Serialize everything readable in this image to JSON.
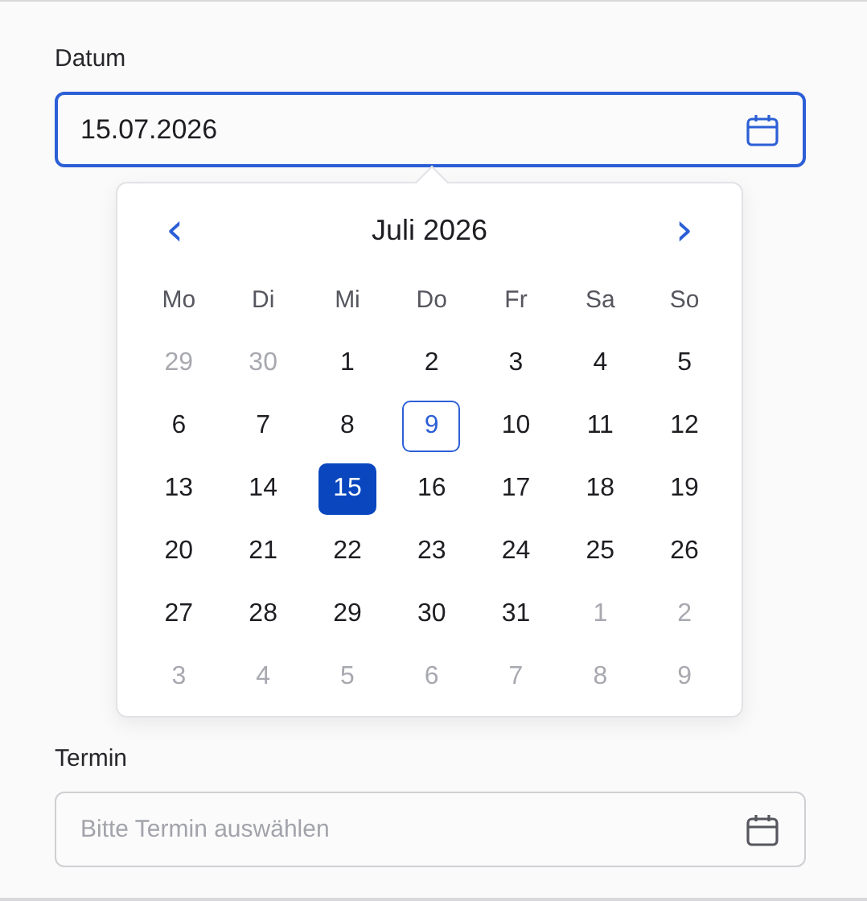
{
  "date_field": {
    "label": "Datum",
    "value": "15.07.2026",
    "focused": true
  },
  "calendar": {
    "prev": "‹",
    "next": "›",
    "month_title": "Juli 2026",
    "weekdays": [
      "Mo",
      "Di",
      "Mi",
      "Do",
      "Fr",
      "Sa",
      "So"
    ],
    "weeks": [
      [
        {
          "text": "29",
          "in_month": false,
          "selected": false,
          "today": false
        },
        {
          "text": "30",
          "in_month": false,
          "selected": false,
          "today": false
        },
        {
          "text": "1",
          "in_month": true,
          "selected": false,
          "today": false
        },
        {
          "text": "2",
          "in_month": true,
          "selected": false,
          "today": false
        },
        {
          "text": "3",
          "in_month": true,
          "selected": false,
          "today": false
        },
        {
          "text": "4",
          "in_month": true,
          "selected": false,
          "today": false
        },
        {
          "text": "5",
          "in_month": true,
          "selected": false,
          "today": false
        }
      ],
      [
        {
          "text": "6",
          "in_month": true,
          "selected": false,
          "today": false
        },
        {
          "text": "7",
          "in_month": true,
          "selected": false,
          "today": false
        },
        {
          "text": "8",
          "in_month": true,
          "selected": false,
          "today": false
        },
        {
          "text": "9",
          "in_month": true,
          "selected": false,
          "today": true
        },
        {
          "text": "10",
          "in_month": true,
          "selected": false,
          "today": false
        },
        {
          "text": "11",
          "in_month": true,
          "selected": false,
          "today": false
        },
        {
          "text": "12",
          "in_month": true,
          "selected": false,
          "today": false
        }
      ],
      [
        {
          "text": "13",
          "in_month": true,
          "selected": false,
          "today": false
        },
        {
          "text": "14",
          "in_month": true,
          "selected": false,
          "today": false
        },
        {
          "text": "15",
          "in_month": true,
          "selected": true,
          "today": false
        },
        {
          "text": "16",
          "in_month": true,
          "selected": false,
          "today": false
        },
        {
          "text": "17",
          "in_month": true,
          "selected": false,
          "today": false
        },
        {
          "text": "18",
          "in_month": true,
          "selected": false,
          "today": false
        },
        {
          "text": "19",
          "in_month": true,
          "selected": false,
          "today": false
        }
      ],
      [
        {
          "text": "20",
          "in_month": true,
          "selected": false,
          "today": false
        },
        {
          "text": "21",
          "in_month": true,
          "selected": false,
          "today": false
        },
        {
          "text": "22",
          "in_month": true,
          "selected": false,
          "today": false
        },
        {
          "text": "23",
          "in_month": true,
          "selected": false,
          "today": false
        },
        {
          "text": "24",
          "in_month": true,
          "selected": false,
          "today": false
        },
        {
          "text": "25",
          "in_month": true,
          "selected": false,
          "today": false
        },
        {
          "text": "26",
          "in_month": true,
          "selected": false,
          "today": false
        }
      ],
      [
        {
          "text": "27",
          "in_month": true,
          "selected": false,
          "today": false
        },
        {
          "text": "28",
          "in_month": true,
          "selected": false,
          "today": false
        },
        {
          "text": "29",
          "in_month": true,
          "selected": false,
          "today": false
        },
        {
          "text": "30",
          "in_month": true,
          "selected": false,
          "today": false
        },
        {
          "text": "31",
          "in_month": true,
          "selected": false,
          "today": false
        },
        {
          "text": "1",
          "in_month": false,
          "selected": false,
          "today": false
        },
        {
          "text": "2",
          "in_month": false,
          "selected": false,
          "today": false
        }
      ],
      [
        {
          "text": "3",
          "in_month": false,
          "selected": false,
          "today": false
        },
        {
          "text": "4",
          "in_month": false,
          "selected": false,
          "today": false
        },
        {
          "text": "5",
          "in_month": false,
          "selected": false,
          "today": false
        },
        {
          "text": "6",
          "in_month": false,
          "selected": false,
          "today": false
        },
        {
          "text": "7",
          "in_month": false,
          "selected": false,
          "today": false
        },
        {
          "text": "8",
          "in_month": false,
          "selected": false,
          "today": false
        },
        {
          "text": "9",
          "in_month": false,
          "selected": false,
          "today": false
        }
      ]
    ]
  },
  "appointment_field": {
    "label": "Termin",
    "placeholder": "Bitte Termin auswählen",
    "focused": false
  }
}
